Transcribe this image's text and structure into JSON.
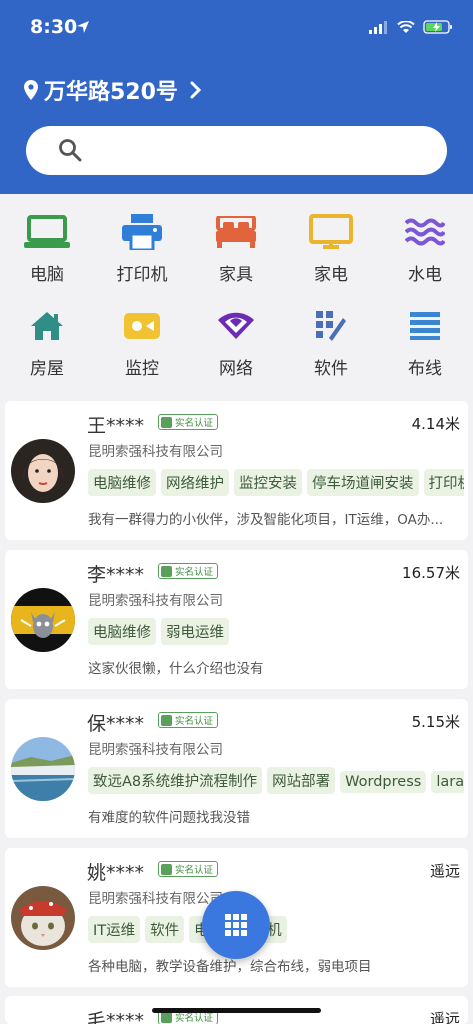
{
  "status_bar": {
    "time": "8:30"
  },
  "header": {
    "address": "万华路520号"
  },
  "search": {
    "placeholder": ""
  },
  "categories": [
    {
      "label": "电脑",
      "icon": "laptop-icon",
      "color": "#3a9b4a"
    },
    {
      "label": "打印机",
      "icon": "printer-icon",
      "color": "#2f7fd8"
    },
    {
      "label": "家具",
      "icon": "bed-icon",
      "color": "#e2643c"
    },
    {
      "label": "家电",
      "icon": "tv-icon",
      "color": "#eab52c"
    },
    {
      "label": "水电",
      "icon": "water-icon",
      "color": "#7b57d8"
    },
    {
      "label": "房屋",
      "icon": "house-icon",
      "color": "#2f8f86"
    },
    {
      "label": "监控",
      "icon": "camera-icon",
      "color": "#f1c232"
    },
    {
      "label": "网络",
      "icon": "wifi-icon",
      "color": "#6b2bb5"
    },
    {
      "label": "软件",
      "icon": "software-icon",
      "color": "#4a6fb8"
    },
    {
      "label": "布线",
      "icon": "cabling-icon",
      "color": "#3b86d2"
    }
  ],
  "verified_label": "实名认证",
  "providers": [
    {
      "name": "王****",
      "company": "昆明索强科技有限公司",
      "distance": "4.14米",
      "tags": [
        "电脑维修",
        "网络维护",
        "监控安装",
        "停车场道闸安装",
        "打印机"
      ],
      "description": "我有一群得力的小伙伴，涉及智能化项目，IT运维，OA办..."
    },
    {
      "name": "李****",
      "company": "昆明索强科技有限公司",
      "distance": "16.57米",
      "tags": [
        "电脑维修",
        "弱电运维"
      ],
      "description": "这家伙很懒，什么介绍也没有"
    },
    {
      "name": "保****",
      "company": "昆明索强科技有限公司",
      "distance": "5.15米",
      "tags": [
        "致远A8系统维护流程制作",
        "网站部署",
        "Wordpress",
        "laravel"
      ],
      "description": "有难度的软件问题找我没错"
    },
    {
      "name": "姚****",
      "company": "昆明索强科技有限公司",
      "distance": "遥远",
      "tags": [
        "IT运维",
        "软件",
        "电脑",
        "打印机"
      ],
      "description": "各种电脑，教学设备维护，综合布线，弱电项目"
    },
    {
      "name": "毛****",
      "company": "",
      "distance": "遥远",
      "tags": [],
      "description": ""
    }
  ]
}
